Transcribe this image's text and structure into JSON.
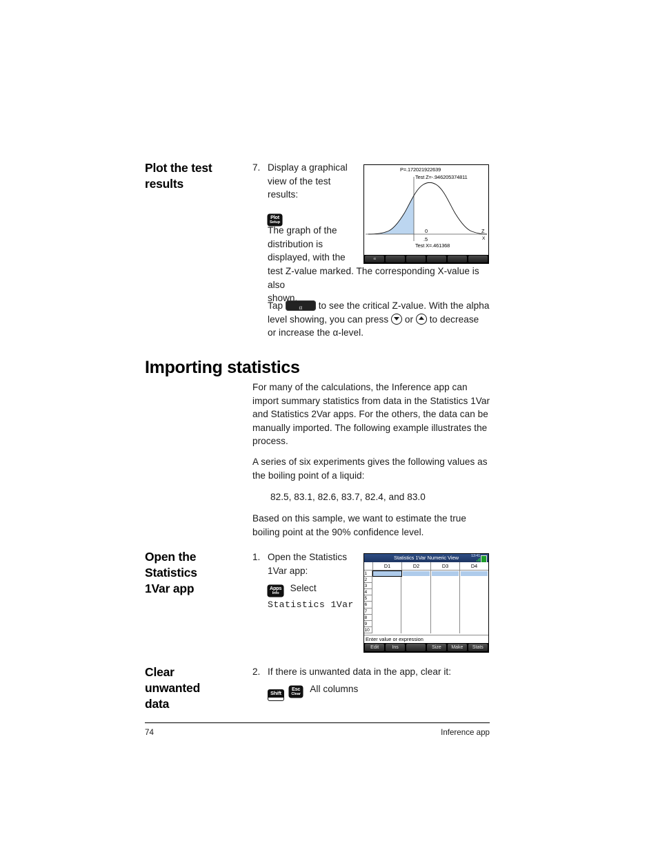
{
  "document": {
    "page_number": "74",
    "footer_right": "Inference app"
  },
  "sections": {
    "plot_results": {
      "side_heading": "Plot the test\nresults",
      "step_number": "7.",
      "intro": "Display a graphical view of the test results:",
      "key_plot": {
        "line1": "Plot",
        "line2": "Setup"
      },
      "graph_desc": "The graph of the distribution is displayed, with the test Z-value marked. The corresponding X-value is also shown.",
      "tap_prefix": "Tap",
      "tap_key_label": "α",
      "tap_middle": "to see the critical Z-value. With the alpha level showing, you can press",
      "tap_or": "or",
      "tap_suffix": "to decrease or increase the α-level."
    },
    "importing": {
      "heading": "Importing statistics",
      "paragraph_1": "For many of the calculations, the Inference app can import summary statistics from data in the Statistics 1Var and Statistics 2Var apps. For the others, the data can be manually imported. The following example illustrates the process.",
      "paragraph_2": "A series of six experiments gives the following values as the boiling point of a liquid:",
      "data_values": "82.5, 83.1, 82.6, 83.7, 82.4, and 83.0",
      "paragraph_3": "Based on this sample, we want to estimate the true boiling point at the 90% confidence level."
    },
    "open_app": {
      "side_heading": "Open the\nStatistics\n1Var app",
      "step_number": "1.",
      "text": "Open the Statistics 1Var app:",
      "key_apps": {
        "line1": "Apps",
        "line2": "Info"
      },
      "select_label": "Select",
      "app_name": "Statistics 1Var"
    },
    "clear_data": {
      "side_heading": "Clear\nunwanted\ndata",
      "step_number": "2.",
      "text": "If there is unwanted data in the app, clear it:",
      "key_shift": {
        "line1": "Shift"
      },
      "key_esc": {
        "line1": "Esc",
        "line2": "Clear"
      },
      "action_label": "All columns"
    }
  },
  "calculator_plot": {
    "label_p": "P=.172021922639",
    "label_testz": "Test Z=-.946205374811",
    "label_zero": "0",
    "label_half": ".5",
    "axis_z": "Z",
    "axis_x": "X",
    "label_testx": "Test X=.461368",
    "softkeys": [
      "α",
      "",
      "",
      "",
      "",
      ""
    ],
    "shade_color": "#bcd6f0",
    "curve_color": "#111111"
  },
  "calculator_sheet": {
    "title": "Statistics 1Var Numeric View",
    "clock": "13:41",
    "columns": [
      "D1",
      "D2",
      "D3",
      "D4"
    ],
    "rows": [
      "1",
      "2",
      "3",
      "4",
      "5",
      "6",
      "7",
      "8",
      "9",
      "10"
    ],
    "entry_line": "Enter value or expression",
    "softkeys": [
      "Edit",
      "Ins",
      "",
      "Size",
      "Make",
      "Stats"
    ],
    "selected_cell": "D1 row 1",
    "highlight_color": "#aecbeb",
    "titlebar_color": "#2e4e84"
  }
}
